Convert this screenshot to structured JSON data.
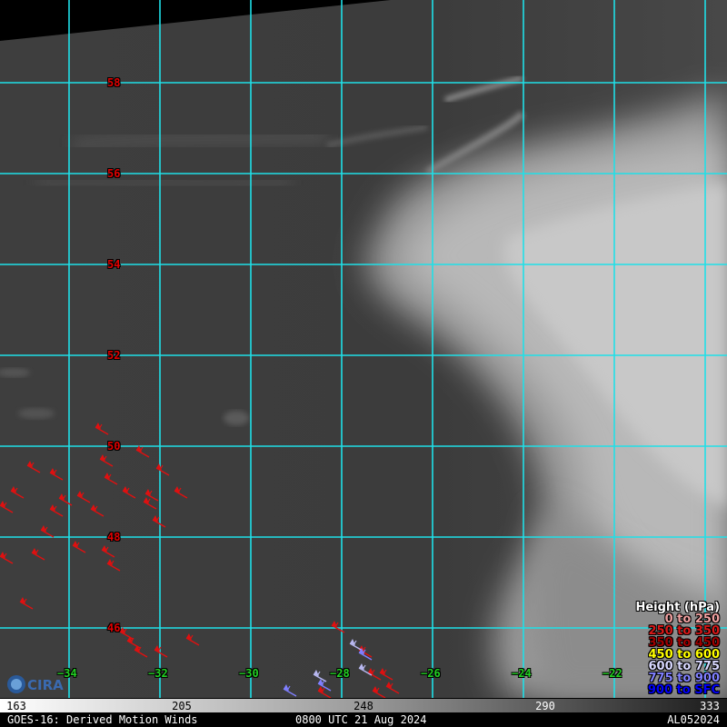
{
  "map": {
    "latitudes": [
      "58",
      "56",
      "54",
      "52",
      "50",
      "48",
      "46"
    ],
    "longitudes": [
      "−34",
      "−32",
      "−30",
      "−28",
      "−26",
      "−24",
      "−22"
    ],
    "lat_range": [
      45,
      59.8
    ],
    "lon_range": [
      -35.5,
      -19.5
    ]
  },
  "legend": {
    "title": "Height (hPa)",
    "entries": [
      {
        "label": "0 to 250",
        "color": "#f0a0a0"
      },
      {
        "label": "250 to 350",
        "color": "#d81818"
      },
      {
        "label": "350 to 450",
        "color": "#a00000"
      },
      {
        "label": "450 to 600",
        "color": "#ffff00"
      },
      {
        "label": "600 to 775",
        "color": "#d8d8ff"
      },
      {
        "label": "775 to 900",
        "color": "#8080ff"
      },
      {
        "label": "900 to SFC",
        "color": "#0000ff"
      }
    ]
  },
  "colorbar": {
    "labels": [
      "163",
      "205",
      "248",
      "290",
      "333"
    ]
  },
  "footer": {
    "left": "GOES-16: Derived Motion Winds",
    "center": "0800 UTC 21 Aug 2024",
    "right": "AL052024"
  },
  "logo_text": "CIRA",
  "wind_colors": {
    "red": "#e01010",
    "lavender": "#b8b8f0",
    "blue": "#7f7fff"
  }
}
